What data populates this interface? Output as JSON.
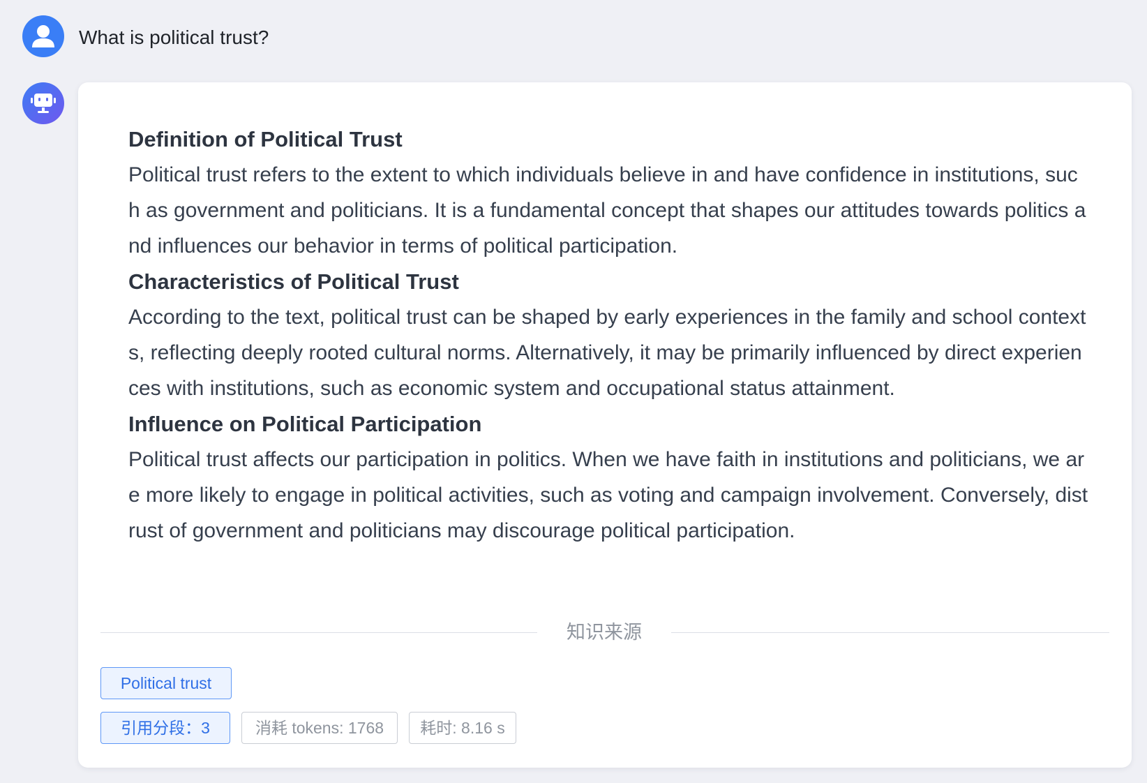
{
  "conversation": {
    "question": "What is political trust?",
    "answer": [
      {
        "heading": "Definition of Political Trust",
        "body": "Political trust refers to the extent to which individuals believe in and have confidence in institutions, such as government and politicians. It is a fundamental concept that shapes our attitudes towards politics and influences our behavior in terms of political participation."
      },
      {
        "heading": "Characteristics of Political Trust",
        "body": "According to the text, political trust can be shaped by early experiences in the family and school contexts, reflecting deeply rooted cultural norms. Alternatively, it may be primarily influenced by direct experiences with institutions, such as economic system and occupational status attainment."
      },
      {
        "heading": "Influence on Political Participation",
        "body": "Political trust affects our participation in politics. When we have faith in institutions and politicians, we are more likely to engage in political activities, such as voting and campaign involvement. Conversely, distrust of government and politicians may discourage political participation."
      }
    ],
    "sources_label": "知识来源",
    "source_doc": "Political trust",
    "citations_label": "引用分段：3",
    "tokens_label": "消耗 tokens: 1768",
    "time_label": "耗时: 8.16 s"
  },
  "icons": {
    "user_avatar": "user-icon",
    "bot_avatar": "robot-icon"
  },
  "colors": {
    "background": "#eff0f5",
    "accent": "#2f6fe6",
    "user_avatar": "#3a7ef6"
  }
}
